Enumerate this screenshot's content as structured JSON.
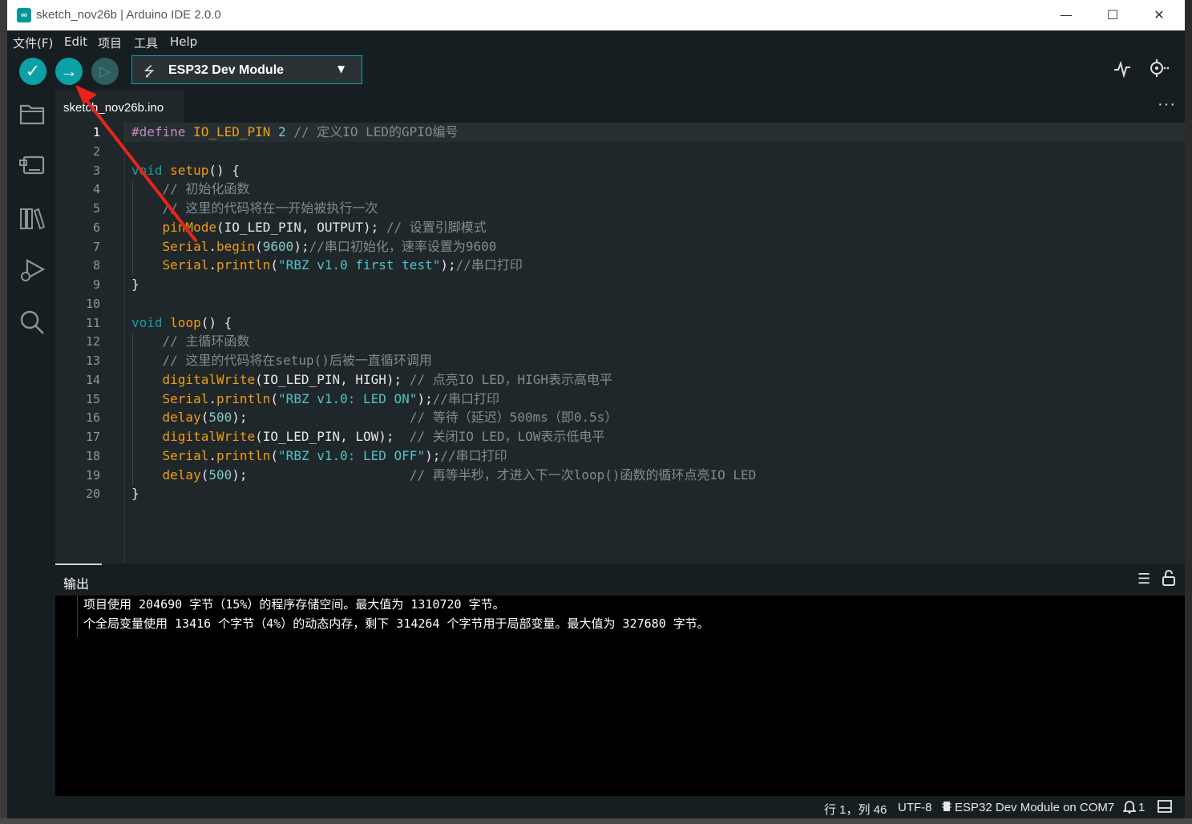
{
  "window": {
    "title": "sketch_nov26b | Arduino IDE 2.0.0",
    "app_icon_glyph": "∞",
    "controls": {
      "minimize": "—",
      "maximize": "☐",
      "close": "✕"
    }
  },
  "menu": [
    "文件(F)",
    "Edit",
    "项目",
    "工具",
    "Help"
  ],
  "toolbar": {
    "verify_icon": "✓",
    "upload_icon": "→",
    "debug_icon": "▷",
    "board": "ESP32 Dev Module",
    "usb_icon": "⭍",
    "caret": "▼",
    "plotter_icon": "⟋",
    "monitor_icon": "⊙"
  },
  "sidebar": {
    "icons": [
      "folder-icon",
      "board-icon",
      "library-icon",
      "debug-icon",
      "search-icon"
    ]
  },
  "editor": {
    "tab": "sketch_nov26b.ino",
    "tab_more": "···",
    "line_numbers": [
      "1",
      "2",
      "3",
      "4",
      "5",
      "6",
      "7",
      "8",
      "9",
      "10",
      "11",
      "12",
      "13",
      "14",
      "15",
      "16",
      "17",
      "18",
      "19",
      "20"
    ],
    "code": {
      "l1": [
        "#define",
        " ",
        "IO_LED_PIN",
        " ",
        "2",
        " ",
        "// 定义IO LED的GPIO编号"
      ],
      "l3": [
        "void",
        " ",
        "setup",
        "() {"
      ],
      "l4": "    // 初始化函数",
      "l5": "    // 这里的代码将在一开始被执行一次",
      "l6": [
        "    ",
        "pinMode",
        "(IO_LED_PIN, OUTPUT); ",
        "// 设置引脚模式"
      ],
      "l7": [
        "    ",
        "Serial",
        ".",
        "begin",
        "(",
        "9600",
        ");",
        "//串口初始化，速率设置为9600"
      ],
      "l8": [
        "    ",
        "Serial",
        ".",
        "println",
        "(",
        "\"RBZ v1.0 first test\"",
        ");",
        "//串口打印"
      ],
      "l9": "}",
      "l11": [
        "void",
        " ",
        "loop",
        "() {"
      ],
      "l12": "    // 主循环函数",
      "l13": "    // 这里的代码将在setup()后被一直循环调用",
      "l14": [
        "    ",
        "digitalWrite",
        "(IO_LED_PIN, HIGH); ",
        "// 点亮IO LED，HIGH表示高电平"
      ],
      "l15": [
        "    ",
        "Serial",
        ".",
        "println",
        "(",
        "\"RBZ v1.0: LED ON\"",
        ");",
        "//串口打印"
      ],
      "l16": [
        "    ",
        "delay",
        "(",
        "500",
        ");",
        "                     ",
        "// 等待（延迟）500ms（即0.5s）"
      ],
      "l17": [
        "    ",
        "digitalWrite",
        "(IO_LED_PIN, LOW);  ",
        "// 关闭IO LED，LOW表示低电平"
      ],
      "l18": [
        "    ",
        "Serial",
        ".",
        "println",
        "(",
        "\"RBZ v1.0: LED OFF\"",
        ");",
        "//串口打印"
      ],
      "l19": [
        "    ",
        "delay",
        "(",
        "500",
        ");",
        "                     ",
        "// 再等半秒，才进入下一次loop()函数的循环点亮IO LED"
      ],
      "l20": "}"
    }
  },
  "output": {
    "title": "输出",
    "clear_icon": "☰",
    "lock_icon": "🔓",
    "lines": [
      "项目使用 204690 字节（15%）的程序存储空间。最大值为 1310720 字节。",
      "个全局变量使用 13416 个字节（4%）的动态内存，剩下 314264 个字节用于局部变量。最大值为 327680 字节。"
    ]
  },
  "status": {
    "position": "行 1，列 46",
    "encoding": "UTF-8",
    "board": "ESP32 Dev Module on COM7",
    "notifications": "1",
    "chip_icon": "▪",
    "bell_icon": "🔔",
    "panel_icon": "▭"
  },
  "colors": {
    "accent": "#0ca1a6",
    "annotation_arrow": "#e8241b"
  }
}
